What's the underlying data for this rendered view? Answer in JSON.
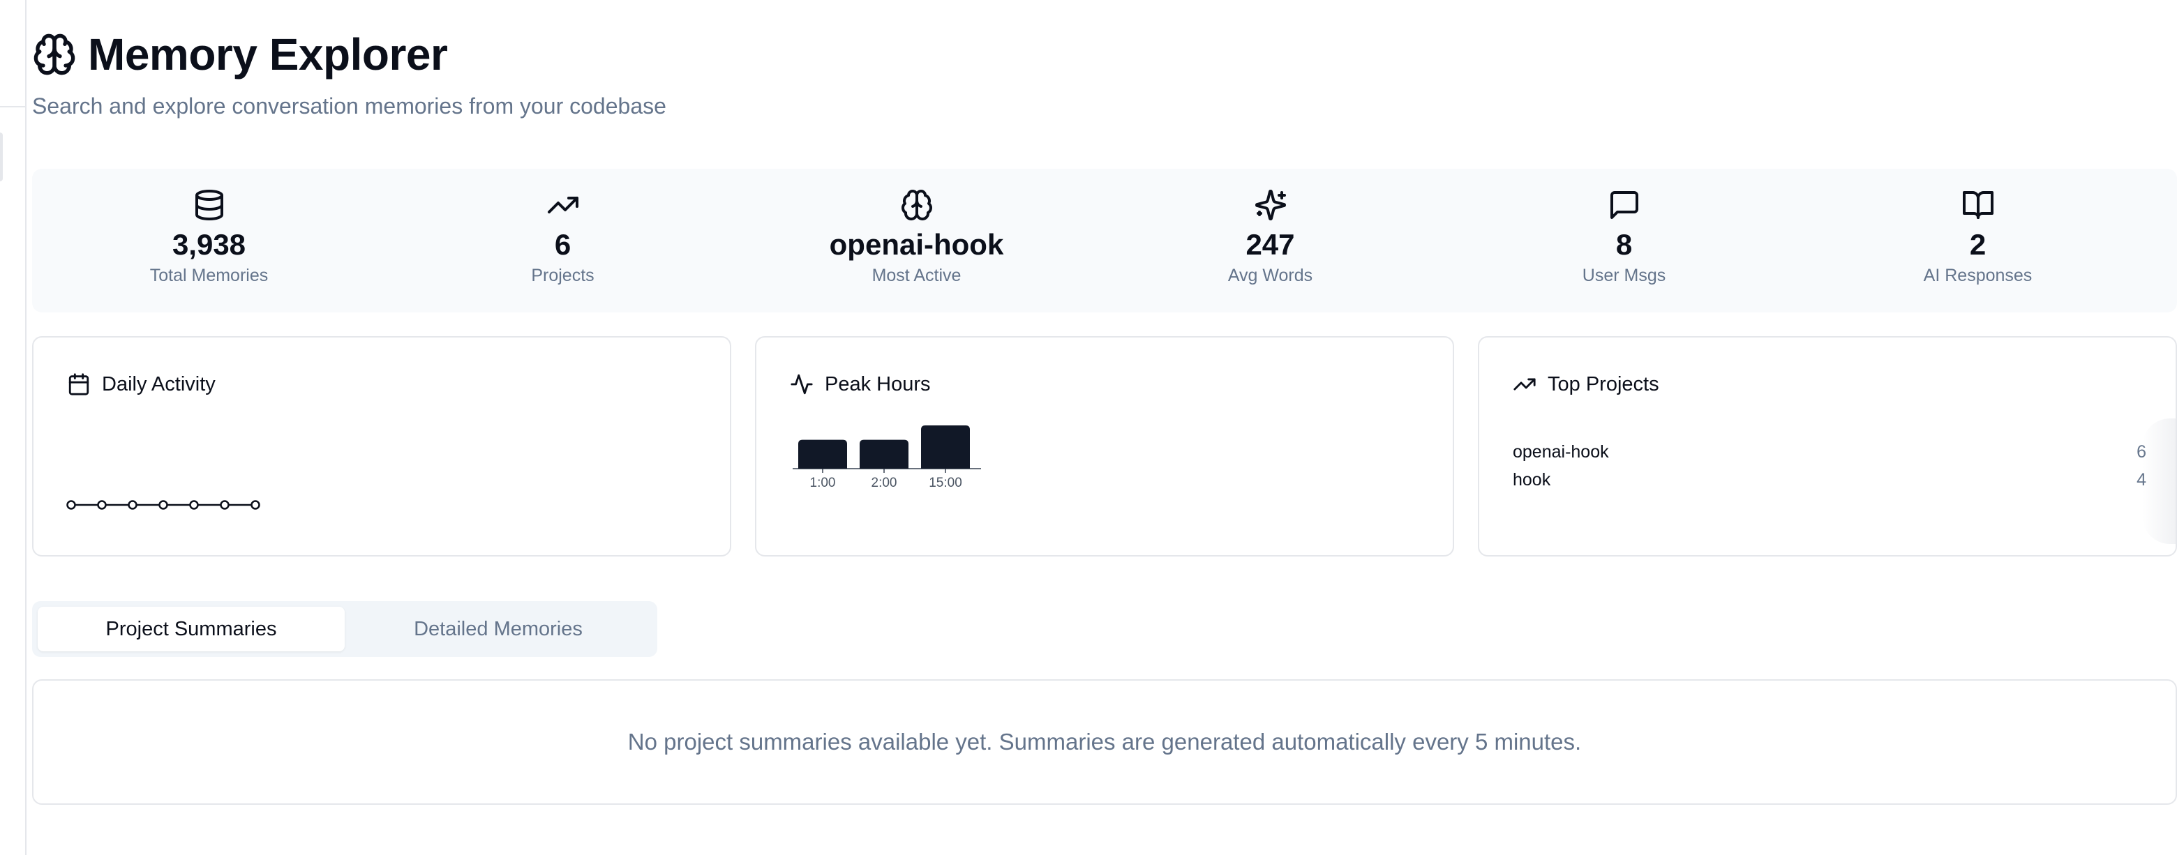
{
  "header": {
    "title": "Memory Explorer",
    "subtitle": "Search and explore conversation memories from your codebase",
    "logo_icon": "brain-icon"
  },
  "stats": [
    {
      "icon": "database-icon",
      "value": "3,938",
      "label": "Total Memories"
    },
    {
      "icon": "trending-up-icon",
      "value": "6",
      "label": "Projects"
    },
    {
      "icon": "brain-icon",
      "value": "openai-hook",
      "label": "Most Active"
    },
    {
      "icon": "sparkles-icon",
      "value": "247",
      "label": "Avg Words"
    },
    {
      "icon": "message-square-icon",
      "value": "8",
      "label": "User Msgs"
    },
    {
      "icon": "book-open-icon",
      "value": "2",
      "label": "AI Responses"
    }
  ],
  "cards": {
    "daily_activity": {
      "title": "Daily Activity",
      "icon": "calendar-icon"
    },
    "peak_hours": {
      "title": "Peak Hours",
      "icon": "activity-icon"
    },
    "top_projects": {
      "title": "Top Projects",
      "icon": "trending-up-icon",
      "items": [
        {
          "name": "openai-hook",
          "count": "6"
        },
        {
          "name": "hook",
          "count": "4"
        }
      ]
    }
  },
  "chart_data": [
    {
      "type": "line",
      "chart": "daily-activity",
      "x": [
        "",
        "",
        "",
        "",
        "",
        "",
        ""
      ],
      "values": [
        0,
        0,
        0,
        0,
        0,
        0,
        0
      ]
    },
    {
      "type": "bar",
      "chart": "peak-hours",
      "categories": [
        "1:00",
        "2:00",
        "15:00"
      ],
      "values": [
        2,
        2,
        3
      ]
    }
  ],
  "tabs": {
    "active": "Project Summaries",
    "inactive": "Detailed Memories"
  },
  "empty_state": {
    "message": "No project summaries available yet. Summaries are generated automatically every 5 minutes."
  },
  "colors": {
    "text_primary": "#0b0f1a",
    "text_muted": "#64748b",
    "bar_fill": "#111827",
    "panel_bg": "#f8fafc",
    "border": "#e5e7eb"
  }
}
